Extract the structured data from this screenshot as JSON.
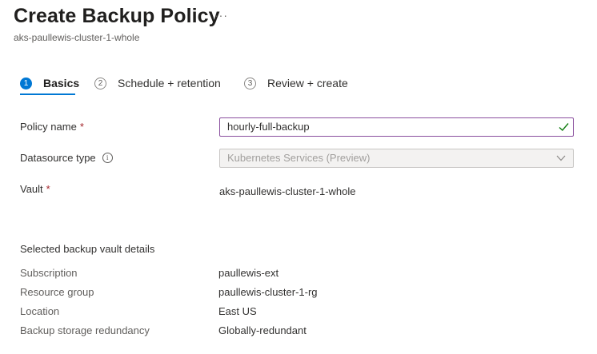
{
  "header": {
    "title": "Create Backup Policy",
    "more_label": "···",
    "subtitle": "aks-paullewis-cluster-1-whole"
  },
  "tabs": [
    {
      "number": "1",
      "label": "Basics",
      "active": true
    },
    {
      "number": "2",
      "label": "Schedule + retention",
      "active": false
    },
    {
      "number": "3",
      "label": "Review + create",
      "active": false
    }
  ],
  "form": {
    "policy_name": {
      "label": "Policy name",
      "required_mark": "*",
      "value": "hourly-full-backup"
    },
    "datasource_type": {
      "label": "Datasource type",
      "info_glyph": "i",
      "value": "Kubernetes Services (Preview)"
    },
    "vault": {
      "label": "Vault",
      "required_mark": "*",
      "value": "aks-paullewis-cluster-1-whole"
    }
  },
  "vault_details": {
    "heading": "Selected backup vault details",
    "rows": [
      {
        "label": "Subscription",
        "value": "paullewis-ext"
      },
      {
        "label": "Resource group",
        "value": "paullewis-cluster-1-rg"
      },
      {
        "label": "Location",
        "value": "East US"
      },
      {
        "label": "Backup storage redundancy",
        "value": "Globally-redundant"
      }
    ]
  },
  "icons": {
    "valid_check": "check-icon",
    "dropdown": "chevron-down-icon",
    "info": "info-icon",
    "more": "more-icon"
  },
  "colors": {
    "accent": "#0078d4",
    "required": "#a4262c",
    "valid": "#107c10",
    "focus_border": "#8a4f9e"
  }
}
